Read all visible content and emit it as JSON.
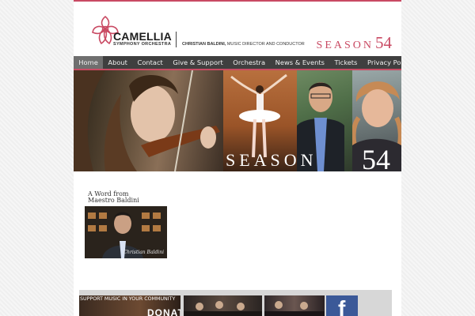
{
  "logo": {
    "name": "CAMELLIA",
    "subtitle": "SYMPHONY ORCHESTRA"
  },
  "header": {
    "conductor_name": "CHRISTIAN BALDINI,",
    "conductor_role": " MUSIC DIRECTOR AND CONDUCTOR",
    "season_word": "SEASON",
    "season_number": "54"
  },
  "nav": {
    "items": [
      {
        "label": "Home",
        "active": true
      },
      {
        "label": "About"
      },
      {
        "label": "Contact"
      },
      {
        "label": "Give & Support"
      },
      {
        "label": "Orchestra"
      },
      {
        "label": "News & Events"
      },
      {
        "label": "Tickets"
      },
      {
        "label": "Privacy Policy"
      }
    ]
  },
  "banner": {
    "season_word": "SEASON",
    "season_number": "54"
  },
  "content": {
    "word_title": "A Word from Maestro Baldini",
    "signature": "Christian Baldini"
  },
  "footer": {
    "support_caption": "SUPPORT MUSIC IN YOUR COMMUNITY",
    "support_big": "DONATE"
  },
  "colors": {
    "accent": "#c94a63",
    "nav_bg": "#3f3f3f",
    "nav_active": "#6f6f6f",
    "facebook": "#3b5998"
  }
}
